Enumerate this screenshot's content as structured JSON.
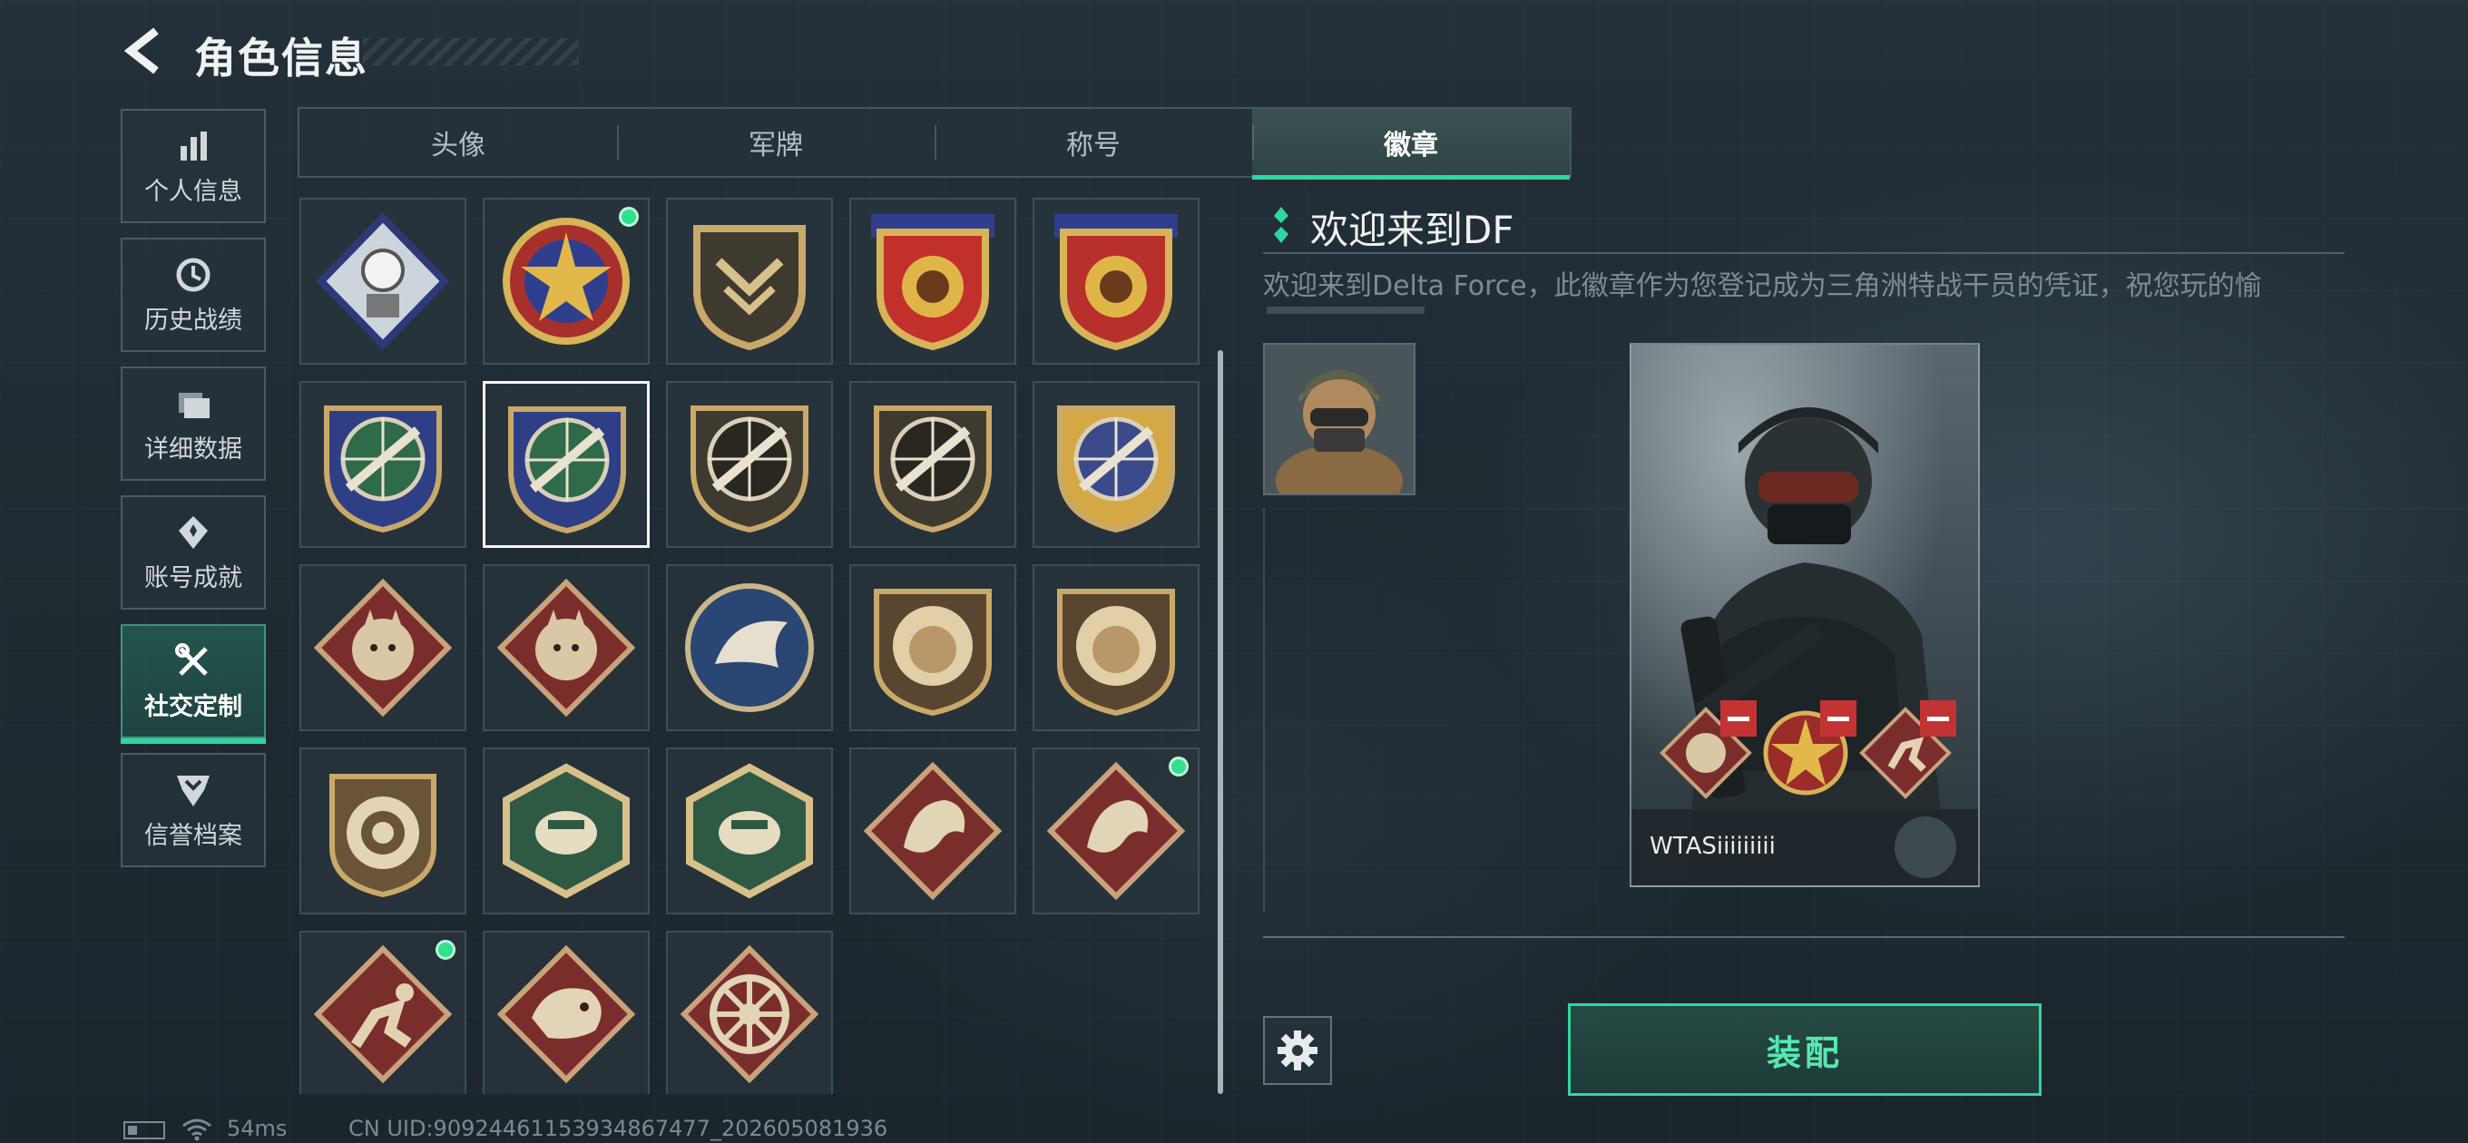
{
  "header": {
    "title": "角色信息",
    "back_icon": "back-arrow-icon"
  },
  "sidebar": {
    "items": [
      {
        "label": "个人信息",
        "icon": "bar-chart-icon",
        "active": false
      },
      {
        "label": "历史战绩",
        "icon": "history-clock-icon",
        "active": false
      },
      {
        "label": "详细数据",
        "icon": "folder-data-icon",
        "active": false
      },
      {
        "label": "账号成就",
        "icon": "medal-icon",
        "active": false
      },
      {
        "label": "社交定制",
        "icon": "tools-icon",
        "active": true
      },
      {
        "label": "信誉档案",
        "icon": "reputation-icon",
        "active": false
      }
    ]
  },
  "tabs": [
    {
      "label": "头像",
      "active": false
    },
    {
      "label": "军牌",
      "active": false
    },
    {
      "label": "称号",
      "active": false
    },
    {
      "label": "徽章",
      "active": true
    }
  ],
  "badges": [
    {
      "icon": "rose-diamond-badge-icon",
      "is_new": false,
      "selected": false
    },
    {
      "icon": "star-compass-badge-icon",
      "is_new": true,
      "selected": false
    },
    {
      "icon": "chevron-shield-badge-icon",
      "is_new": false,
      "selected": false
    },
    {
      "icon": "gold-star-crest-badge-icon",
      "is_new": false,
      "selected": false
    },
    {
      "icon": "red-crest-badge-icon",
      "is_new": false,
      "selected": false
    },
    {
      "icon": "rifle-target-shield-blue-icon",
      "is_new": false,
      "selected": false
    },
    {
      "icon": "rifle-target-shield-selected-icon",
      "is_new": false,
      "selected": true
    },
    {
      "icon": "rifle-emblem-brown-icon",
      "is_new": false,
      "selected": false
    },
    {
      "icon": "rifle-emblem-dark-icon",
      "is_new": false,
      "selected": false
    },
    {
      "icon": "gold-rifle-crest-icon",
      "is_new": false,
      "selected": false
    },
    {
      "icon": "wolf-diamond-badge-icon",
      "is_new": false,
      "selected": false
    },
    {
      "icon": "wolf-diamond-red-badge-icon",
      "is_new": false,
      "selected": false
    },
    {
      "icon": "eagle-round-badge-icon",
      "is_new": false,
      "selected": false
    },
    {
      "icon": "lion-shield-badge-icon",
      "is_new": false,
      "selected": false
    },
    {
      "icon": "lion-shield-dark-badge-icon",
      "is_new": false,
      "selected": false
    },
    {
      "icon": "target-shield-badge-icon",
      "is_new": false,
      "selected": false
    },
    {
      "icon": "wasp-hex-badge-icon",
      "is_new": false,
      "selected": false
    },
    {
      "icon": "pistol-hex-badge-icon",
      "is_new": false,
      "selected": false
    },
    {
      "icon": "dragon-diamond-badge-icon",
      "is_new": false,
      "selected": false
    },
    {
      "icon": "dragon-diamond-dark-badge-icon",
      "is_new": true,
      "selected": false
    },
    {
      "icon": "runner-diamond-badge-icon",
      "is_new": true,
      "selected": false
    },
    {
      "icon": "snake-diamond-badge-icon",
      "is_new": false,
      "selected": false
    },
    {
      "icon": "wheel-diamond-badge-icon",
      "is_new": false,
      "selected": false
    }
  ],
  "detail": {
    "title": "欢迎来到DF",
    "description": "欢迎来到Delta Force，此徽章作为您登记成为三角洲特战干员的凭证，祝您玩的愉",
    "card": {
      "player_name": "WTASiiiiiiiii",
      "equipped_slots": [
        "wolf-diamond-badge-icon",
        "star-compass-badge-icon",
        "runner-diamond-badge-icon"
      ]
    },
    "settings_icon": "gear-icon",
    "equip_label": "装配"
  },
  "footer": {
    "ping": "54ms",
    "uid": "CN UID:9092446115393486747​7_202605081936"
  },
  "colors": {
    "accent": "#2fd7a0",
    "new_dot": "#2fe08f",
    "remove": "#c23434"
  }
}
